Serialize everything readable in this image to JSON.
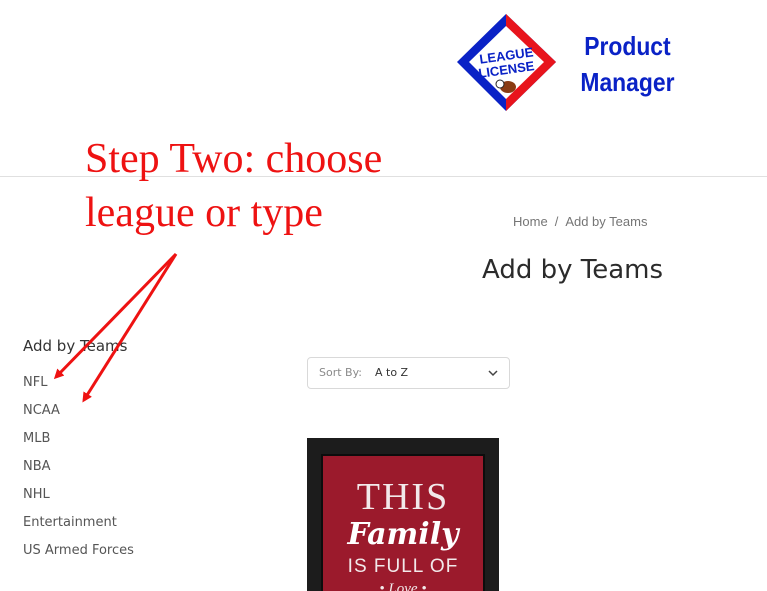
{
  "logo": {
    "badge_line1": "LEAGUE",
    "badge_line2": "LICENSE",
    "title_line1": "Product",
    "title_line2": "Manager",
    "colors": {
      "blue": "#0a22c6",
      "red": "#e8141c",
      "title": "#0a22c6"
    }
  },
  "annotation": {
    "line1": "Step Two: choose",
    "line2": "league or type",
    "color": "#ee1212"
  },
  "breadcrumb": {
    "home": "Home",
    "separator": "/",
    "current": "Add by Teams"
  },
  "page_title": "Add by Teams",
  "sidebar": {
    "heading": "Add by Teams",
    "items": [
      {
        "label": "NFL"
      },
      {
        "label": "NCAA"
      },
      {
        "label": "MLB"
      },
      {
        "label": "NBA"
      },
      {
        "label": "NHL"
      },
      {
        "label": "Entertainment"
      },
      {
        "label": "US Armed Forces"
      }
    ]
  },
  "sort": {
    "label": "Sort By:",
    "selected": "A to Z",
    "icon": "chevron-down-icon"
  },
  "product": {
    "line1": "THIS",
    "line2": "Family",
    "line3": "IS FULL OF",
    "line4": "• Love •",
    "colors": {
      "frame": "#1c1c1c",
      "background": "#9b1a2c"
    }
  }
}
